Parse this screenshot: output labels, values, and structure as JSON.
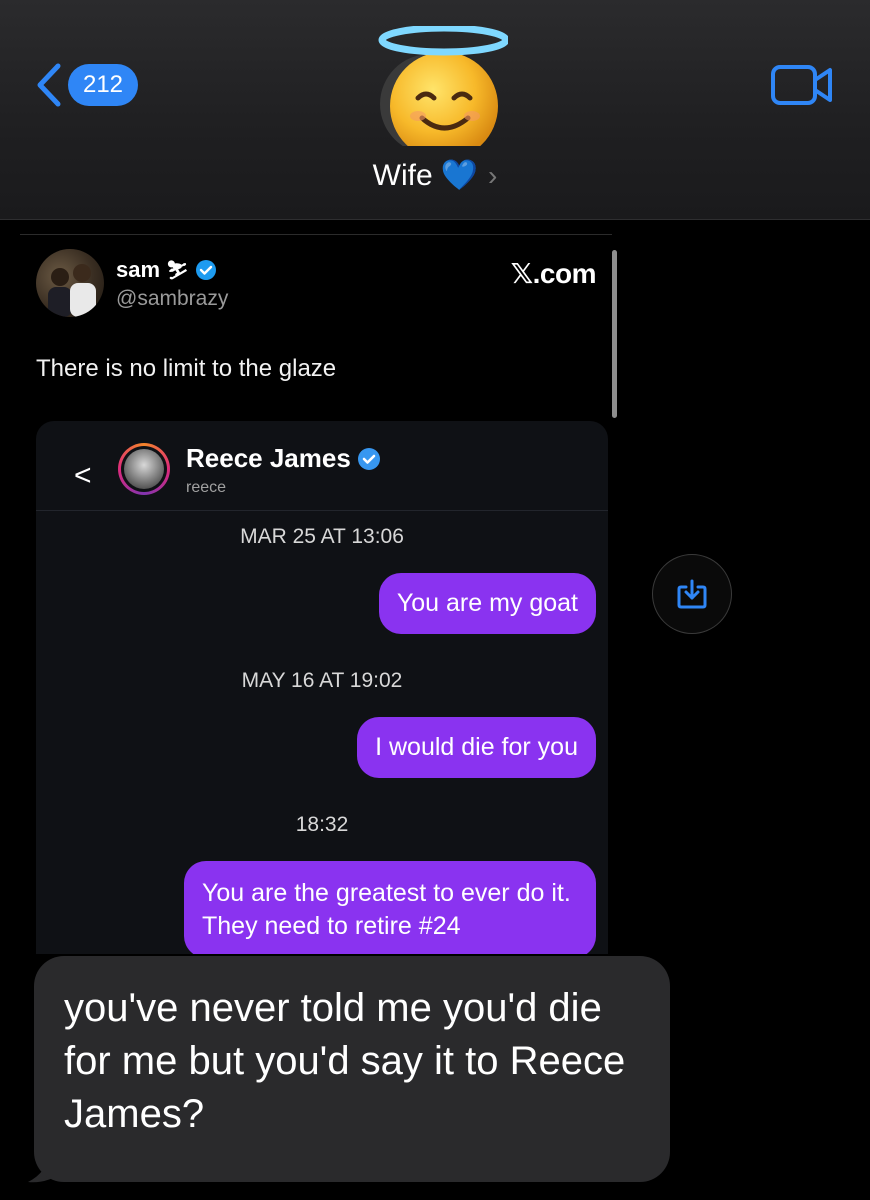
{
  "header": {
    "back_count": "212",
    "contact_name": "Wife",
    "contact_emoji": "💙",
    "chevron": "›",
    "avatar_emoji": "😇",
    "accent_color": "#2f86f6"
  },
  "tweet": {
    "name": "sam",
    "handle": "@sambrazy",
    "source": "𝕏.com",
    "text": "There is no limit to the glaze"
  },
  "dm": {
    "name": "Reece James",
    "username": "reece",
    "back_symbol": "<",
    "bubble_color": "#8a33f0",
    "messages": [
      {
        "timestamp": "MAR 25 AT 13:06",
        "text": "You are my goat"
      },
      {
        "timestamp": "MAY 16 AT 19:02",
        "text": "I would die for you"
      },
      {
        "timestamp": "18:32",
        "text": "You are the greatest to ever do it. They need to retire #24"
      }
    ]
  },
  "incoming_message": {
    "text": "you've never told me you'd die for me but you'd say it to Reece James?"
  }
}
